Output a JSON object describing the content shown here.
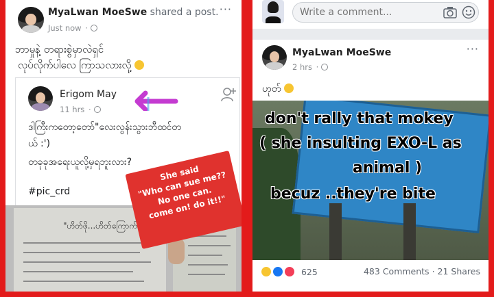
{
  "left_post": {
    "author": "MyaLwan MoeSwe",
    "action": "shared a post.",
    "time": "Just now",
    "text_line1": "ဘာမှုနဲ့ တရားစွဲမှာလဲရှင်",
    "text_line2": "လုပ်လိုက်ပါလေ ကြာသလားလို့",
    "shared": {
      "author": "Erigom May",
      "time": "11 hrs",
      "text_line1": "ဒါကြီးကတော့တော်\"လေးလွန်းသွားဘီထင်တ",
      "text_line2": "ယ် :')",
      "text_line3": "တခုခုအရေးယူလို့မှရဘူးလား?",
      "hashtag": "#pic_crd"
    },
    "photo_caption": "\"ဟိတ်ဖို...ဟိတ်ကြောက်\"",
    "annotation_line1": "She said",
    "annotation_line2": "\"Who can sue me??",
    "annotation_line3": "No one can.",
    "annotation_line4": "come on! do it!!\""
  },
  "right_post": {
    "comment_placeholder": "Write a comment...",
    "author": "MyaLwan MoeSwe",
    "time": "2 hrs",
    "text": "ဟုတ်",
    "meme_line1": "don't rally that mokey",
    "meme_line2": "( she insulting EXO-L as",
    "meme_line3": "animal )",
    "meme_line4": "becuz ..they're bite",
    "reaction_count": "625",
    "comments": "483 Comments",
    "shares": "21 Shares"
  },
  "colors": {
    "frame": "#e31b1b",
    "annotation_box": "#e0322e",
    "arrow": "#c43bd1",
    "sign": "#2f86c6"
  },
  "icons": [
    "globe-icon",
    "more-options-icon",
    "add-friend-icon",
    "camera-icon",
    "sticker-icon",
    "haha-reaction-icon",
    "like-reaction-icon",
    "love-reaction-icon"
  ]
}
